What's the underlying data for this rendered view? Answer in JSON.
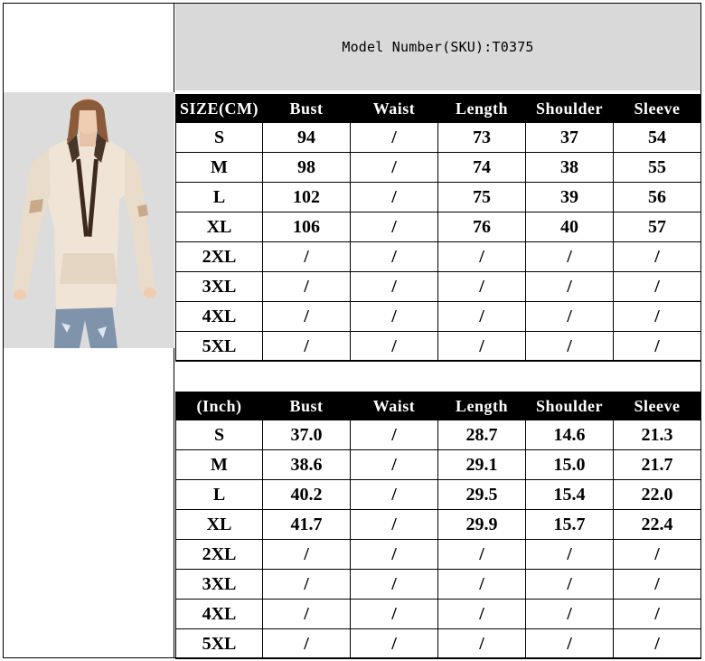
{
  "header": {
    "model_number": "Model Number(SKU):T0375"
  },
  "cm_table": {
    "columns": [
      "SIZE(CM)",
      "Bust",
      "Waist",
      "Length",
      "Shoulder",
      "Sleeve"
    ],
    "rows": [
      [
        "S",
        "94",
        "/",
        "73",
        "37",
        "54"
      ],
      [
        "M",
        "98",
        "/",
        "74",
        "38",
        "55"
      ],
      [
        "L",
        "102",
        "/",
        "75",
        "39",
        "56"
      ],
      [
        "XL",
        "106",
        "/",
        "76",
        "40",
        "57"
      ],
      [
        "2XL",
        "/",
        "/",
        "/",
        "/",
        "/"
      ],
      [
        "3XL",
        "/",
        "/",
        "/",
        "/",
        "/"
      ],
      [
        "4XL",
        "/",
        "/",
        "/",
        "/",
        "/"
      ],
      [
        "5XL",
        "/",
        "/",
        "/",
        "/",
        "/"
      ]
    ]
  },
  "inch_table": {
    "columns": [
      "(Inch)",
      "Bust",
      "Waist",
      "Length",
      "Shoulder",
      "Sleeve"
    ],
    "rows": [
      [
        "S",
        "37.0",
        "/",
        "28.7",
        "14.6",
        "21.3"
      ],
      [
        "M",
        "38.6",
        "/",
        "29.1",
        "15.0",
        "21.7"
      ],
      [
        "L",
        "40.2",
        "/",
        "29.5",
        "15.4",
        "22.0"
      ],
      [
        "XL",
        "41.7",
        "/",
        "29.9",
        "15.7",
        "22.4"
      ],
      [
        "2XL",
        "/",
        "/",
        "/",
        "/",
        "/"
      ],
      [
        "3XL",
        "/",
        "/",
        "/",
        "/",
        "/"
      ],
      [
        "4XL",
        "/",
        "/",
        "/",
        "/",
        "/"
      ],
      [
        "5XL",
        "/",
        "/",
        "/",
        "/",
        "/"
      ]
    ]
  },
  "colors": {
    "header_bg": "#d9d9d9",
    "table_header_bg": "#000000",
    "hoodie": "#efe4d6",
    "jeans": "#7f93ab"
  }
}
